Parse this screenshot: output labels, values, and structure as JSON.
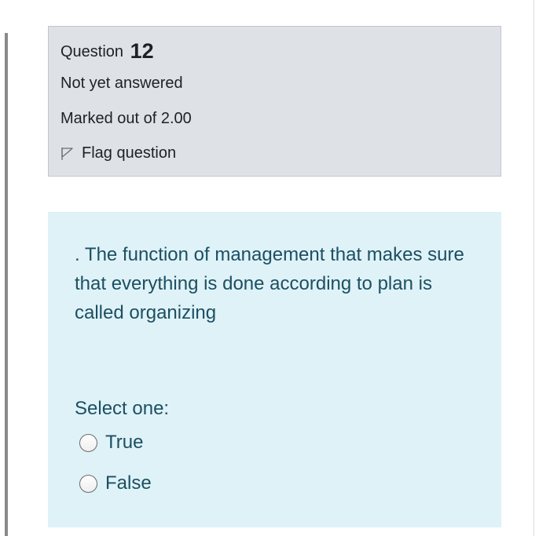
{
  "question": {
    "label": "Question",
    "number": "12",
    "state": "Not yet answered",
    "grade": "Marked out of 2.00",
    "flag_label": "Flag question",
    "flag_icon": "flag-outline-icon"
  },
  "content": {
    "text": ". The function of management that makes sure that everything is done according to plan is called organizing",
    "prompt": "Select one:",
    "options": [
      {
        "label": "True",
        "selected": false
      },
      {
        "label": "False",
        "selected": false
      }
    ]
  },
  "colors": {
    "info_bg": "#dee2e6",
    "content_bg": "#def2f8",
    "content_text": "#1d4f61"
  }
}
